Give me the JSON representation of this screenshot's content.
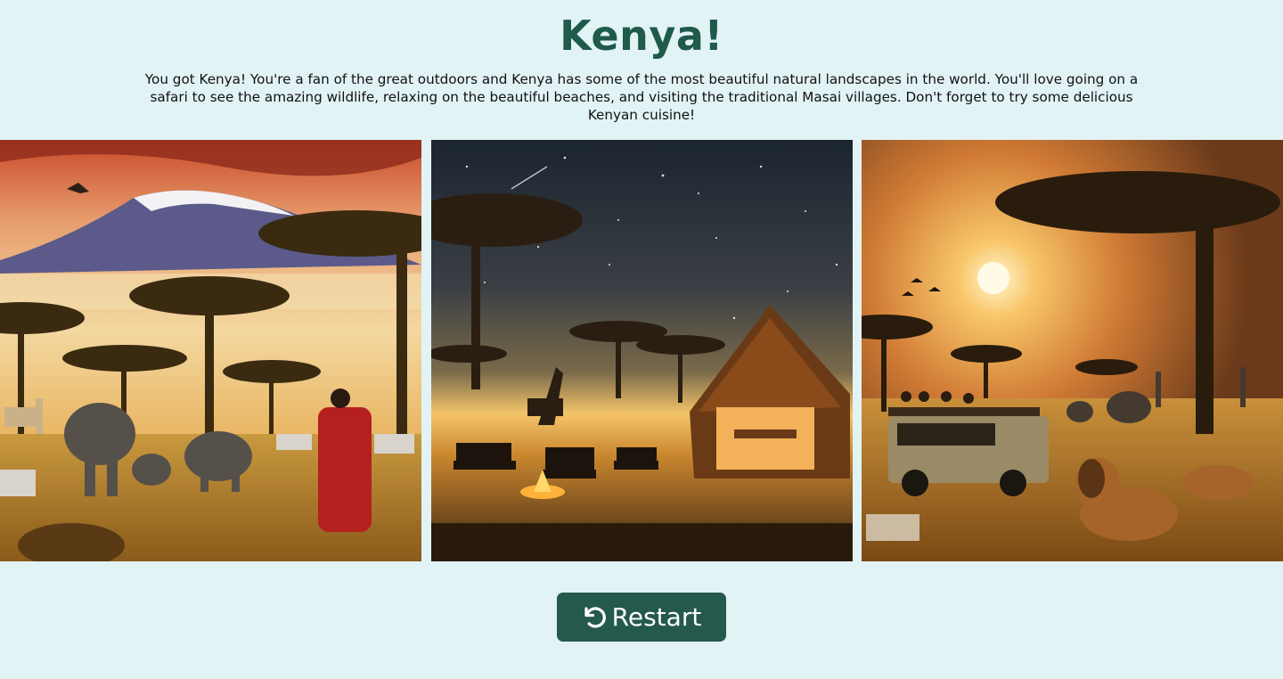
{
  "result": {
    "title": "Kenya!",
    "description": "You got Kenya! You're a fan of the great outdoors and Kenya has some of the most beautiful natural landscapes in the world. You'll love going on a safari to see the amazing wildlife, relaxing on the beautiful beaches, and visiting the traditional Masai villages. Don't forget to try some delicious Kenyan cuisine!"
  },
  "gallery": {
    "images": [
      {
        "subject": "kilimanjaro-savanna-wildlife"
      },
      {
        "subject": "night-safari-camp"
      },
      {
        "subject": "sunset-safari-jeep-lions"
      }
    ]
  },
  "actions": {
    "restart_label": "Restart",
    "restart_icon": "rotate-left-icon"
  },
  "colors": {
    "background": "#e2f3f5",
    "title": "#1f5a4b",
    "button": "#24594b"
  }
}
